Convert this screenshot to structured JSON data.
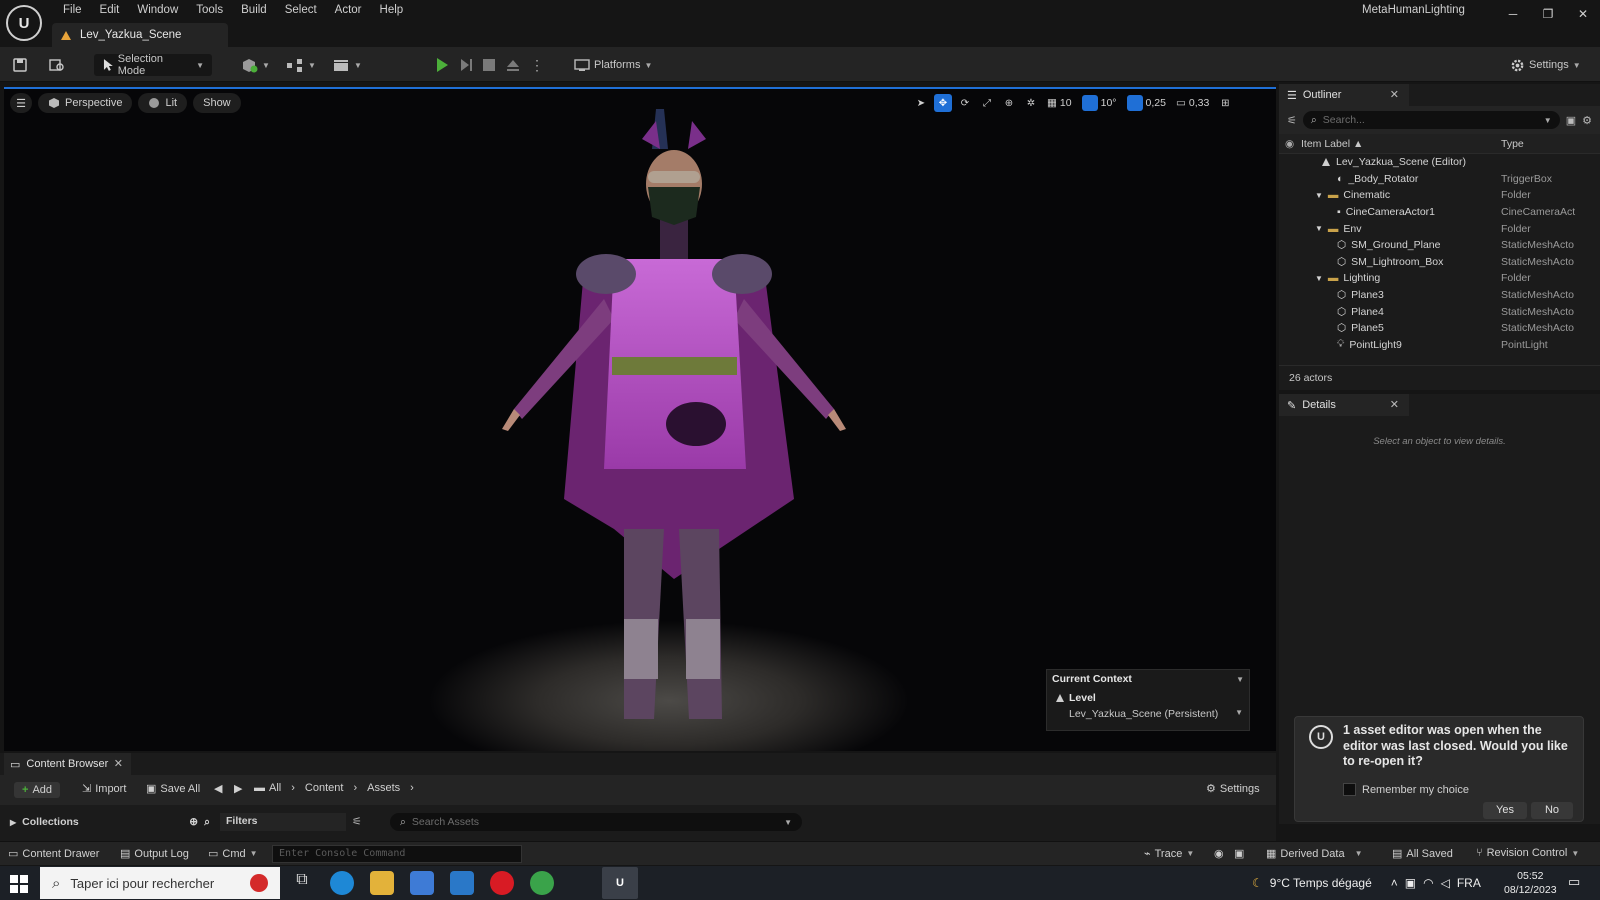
{
  "menu": [
    "File",
    "Edit",
    "Window",
    "Tools",
    "Build",
    "Select",
    "Actor",
    "Help"
  ],
  "project_name": "MetaHumanLighting",
  "level_tab": "Lev_Yazkua_Scene",
  "toolbar": {
    "selection_mode": "Selection Mode",
    "platforms": "Platforms",
    "settings": "Settings"
  },
  "viewport": {
    "perspective": "Perspective",
    "lit": "Lit",
    "show": "Show",
    "grid_snap": "10",
    "rotation_snap": "10°",
    "scale_snap": "0,25",
    "camera_speed": "0,33"
  },
  "current_context": {
    "title": "Current Context",
    "level_label": "Level",
    "level_value": "Lev_Yazkua_Scene (Persistent)"
  },
  "outliner": {
    "tab": "Outliner",
    "search_placeholder": "Search...",
    "col_label": "Item Label ▲",
    "col_type": "Type",
    "rows": [
      {
        "label": "Lev_Yazkua_Scene (Editor)",
        "type": ""
      },
      {
        "label": "_Body_Rotator",
        "type": "TriggerBox"
      },
      {
        "label": "Cinematic",
        "type": "Folder"
      },
      {
        "label": "CineCameraActor1",
        "type": "CineCameraAct"
      },
      {
        "label": "Env",
        "type": "Folder"
      },
      {
        "label": "SM_Ground_Plane",
        "type": "StaticMeshActo"
      },
      {
        "label": "SM_Lightroom_Box",
        "type": "StaticMeshActo"
      },
      {
        "label": "Lighting",
        "type": "Folder"
      },
      {
        "label": "Plane3",
        "type": "StaticMeshActo"
      },
      {
        "label": "Plane4",
        "type": "StaticMeshActo"
      },
      {
        "label": "Plane5",
        "type": "StaticMeshActo"
      },
      {
        "label": "PointLight9",
        "type": "PointLight"
      }
    ],
    "actor_count": "26 actors"
  },
  "details": {
    "tab": "Details",
    "empty_text": "Select an object to view details."
  },
  "notification": {
    "message": "1 asset editor was open when the editor was last closed. Would you like to re-open it?",
    "remember": "Remember my choice",
    "yes": "Yes",
    "no": "No"
  },
  "content_browser": {
    "tab": "Content Browser",
    "add": "Add",
    "import": "Import",
    "save_all": "Save All",
    "path": [
      "All",
      "Content",
      "Assets"
    ],
    "settings": "Settings",
    "collections": "Collections",
    "filters": "Filters",
    "search_placeholder": "Search Assets"
  },
  "status_bar": {
    "content_drawer": "Content Drawer",
    "output_log": "Output Log",
    "cmd": "Cmd",
    "console_placeholder": "Enter Console Command",
    "trace": "Trace",
    "derived_data": "Derived Data",
    "all_saved": "All Saved",
    "revision_control": "Revision Control"
  },
  "taskbar": {
    "search_text": "Taper ici pour rechercher",
    "weather": "9°C  Temps dégagé",
    "language": "FRA",
    "time": "05:52",
    "date": "08/12/2023"
  },
  "colors": {
    "accent": "#1f6fd6",
    "panel": "#242424",
    "background": "#151515",
    "play_green": "#4caf3a"
  }
}
